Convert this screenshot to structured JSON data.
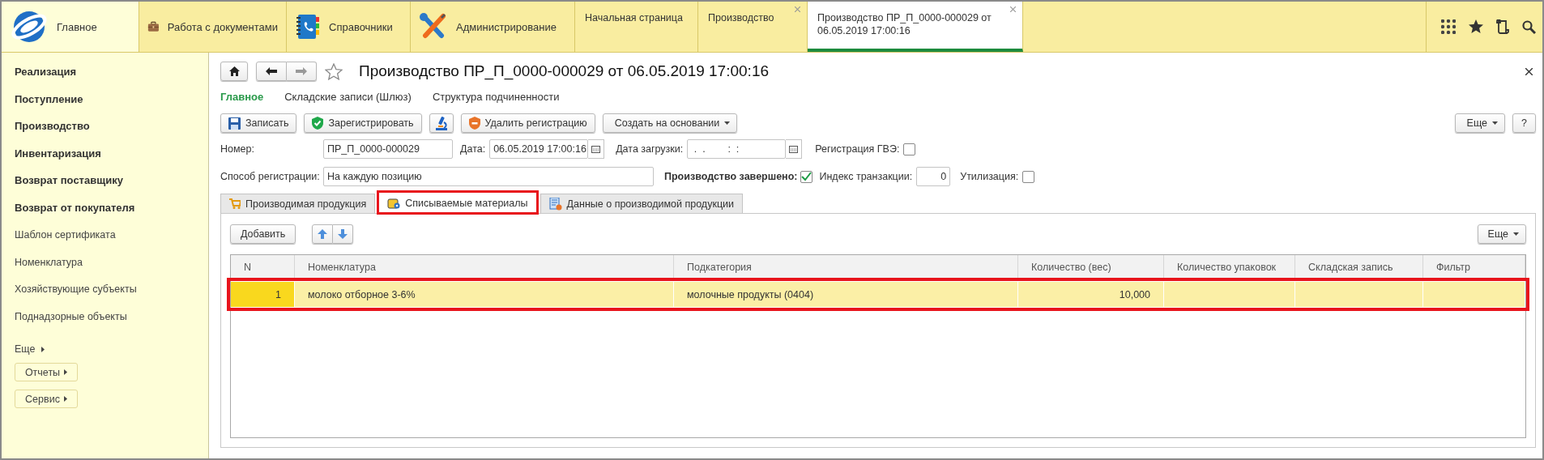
{
  "top_sections": [
    {
      "label": "Главное",
      "kind": "home",
      "selected": true
    },
    {
      "label": "Работа с документами",
      "kind": "briefcase",
      "selected": false
    },
    {
      "label": "Справочники",
      "kind": "book",
      "selected": false
    },
    {
      "label": "Администрирование",
      "kind": "tools",
      "selected": false
    }
  ],
  "open_tabs": [
    {
      "label": "Начальная страница",
      "selected": false,
      "closable": false
    },
    {
      "label": "Производство",
      "selected": false,
      "closable": true
    },
    {
      "label": "Производство ПР_П_0000-000029 от 06.05.2019 17:00:16",
      "selected": true,
      "closable": true
    }
  ],
  "sidebar": {
    "items": [
      {
        "label": "Реализация",
        "kind": "bold"
      },
      {
        "label": "Поступление",
        "kind": "bold"
      },
      {
        "label": "Производство",
        "kind": "bold"
      },
      {
        "label": "Инвентаризация",
        "kind": "bold"
      },
      {
        "label": "Возврат поставщику",
        "kind": "bold"
      },
      {
        "label": "Возврат от покупателя",
        "kind": "bold"
      },
      {
        "label": "Шаблон сертификата",
        "kind": "normal"
      },
      {
        "label": "Номенклатура",
        "kind": "normal"
      },
      {
        "label": "Хозяйствующие субъекты",
        "kind": "normal"
      },
      {
        "label": "Поднадзорные объекты",
        "kind": "normal"
      }
    ],
    "more": "Еще",
    "buttons": [
      "Отчеты",
      "Сервис"
    ]
  },
  "form": {
    "title": "Производство ПР_П_0000-000029 от 06.05.2019 17:00:16",
    "nav": [
      {
        "label": "Главное",
        "selected": true
      },
      {
        "label": "Складские записи (Шлюз)",
        "selected": false
      },
      {
        "label": "Структура подчиненности",
        "selected": false
      }
    ],
    "toolbar": [
      {
        "label": "Записать",
        "kind": "save"
      },
      {
        "kind": "register",
        "label": "Зарегистрировать"
      },
      {
        "kind": "microscope"
      },
      {
        "kind": "unregister",
        "label": "Удалить регистрацию"
      },
      {
        "kind": "dropdown",
        "label": "Создать на основании"
      }
    ],
    "toolbar_right": [
      {
        "kind": "dropdown",
        "label": "Еще"
      },
      {
        "kind": "plain",
        "label": "?"
      }
    ],
    "number": {
      "label": "Номер:",
      "value": "ПР_П_0000-000029"
    },
    "date": {
      "label": "Дата:",
      "value": "06.05.2019 17:00:16"
    },
    "load_date": {
      "label": "Дата загрузки:",
      "value": " .  .        :  :"
    },
    "gve": {
      "label": "Регистрация ГВЭ:",
      "checked": false
    },
    "method": {
      "label": "Способ регистрации:",
      "value": "На каждую позицию"
    },
    "completed": {
      "label": "Производство завершено:",
      "checked": true
    },
    "tx_index": {
      "label": "Индекс транзакции:",
      "value": "0"
    },
    "disposal": {
      "label": "Утилизация:",
      "checked": false
    },
    "tabs": [
      {
        "label": "Производимая продукция",
        "kind": "cart",
        "selected": false,
        "highlighted": false
      },
      {
        "label": "Списываемые материалы",
        "kind": "materials",
        "selected": true,
        "highlighted": true
      },
      {
        "label": "Данные о производимой продукции",
        "kind": "document",
        "selected": false,
        "highlighted": false
      }
    ],
    "table": {
      "add_button": "Добавить",
      "more_button": "Еще",
      "columns": [
        "N",
        "Номенклатура",
        "Подкатегория",
        "Количество (вес)",
        "Количество упаковок",
        "Складская запись",
        "Фильтр"
      ],
      "rows": [
        {
          "n": "1",
          "nomenclature": "молоко отборное 3-6%",
          "subcategory": "молочные продукты (0404)",
          "weight": "10,000",
          "selected": true,
          "highlighted": true
        }
      ]
    }
  }
}
